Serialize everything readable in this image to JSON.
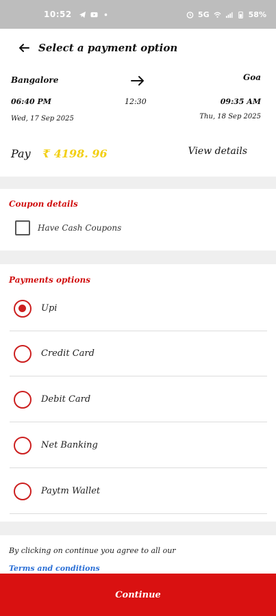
{
  "status_bar": {
    "time": "10:52",
    "network": "5G",
    "battery": "58%",
    "icons": [
      "telegram-icon",
      "youtube-icon",
      "dot-icon",
      "alarm-icon",
      "wifi-icon",
      "signal-icon",
      "battery-icon"
    ]
  },
  "header": {
    "title": "Select a payment option"
  },
  "trip": {
    "from_city": "Bangalore",
    "to_city": "Goa",
    "departure_time": "06:40 PM",
    "duration": "12:30",
    "arrival_time": "09:35 AM",
    "departure_date": "Wed, 17 Sep 2025",
    "arrival_date": "Thu, 18 Sep 2025",
    "pay_label": "Pay",
    "pay_amount": "₹ 4198. 96",
    "view_details": "View details"
  },
  "coupon": {
    "section_title": "Coupon details",
    "checkbox_label": "Have Cash Coupons",
    "checked": false
  },
  "payments": {
    "section_title": "Payments options",
    "options": [
      {
        "label": "Upi",
        "selected": true
      },
      {
        "label": "Credit Card",
        "selected": false
      },
      {
        "label": "Debit Card",
        "selected": false
      },
      {
        "label": "Net Banking",
        "selected": false
      },
      {
        "label": "Paytm Wallet",
        "selected": false
      }
    ]
  },
  "consent": {
    "text": "By clicking on continue you agree to all our",
    "terms_link": "Terms and conditions"
  },
  "continue_button": "Continue",
  "colors": {
    "accent_red": "#d91111",
    "amount_yellow": "#f2cf13",
    "link_blue": "#2b6fd6"
  }
}
